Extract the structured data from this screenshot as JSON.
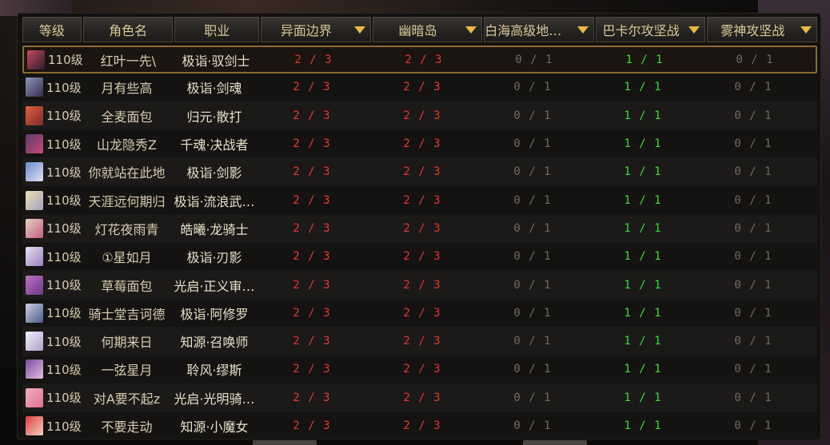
{
  "header": {
    "level": "等级",
    "name": "角色名",
    "job": "职业",
    "raids": [
      "异面边界",
      "幽暗岛",
      "白海高级地下…",
      "巴卡尔攻坚战",
      "雾神攻坚战"
    ]
  },
  "colors": {
    "red": "#e03a32",
    "gray": "#6e6a66",
    "green": "#3bdc3b",
    "header_text": "#d9c89a",
    "arrow": "#e8b84a",
    "selected_border": "#8a6a30"
  },
  "rows": [
    {
      "level": "110级",
      "name": "红叶一先\\",
      "job": "极诣·驭剑士",
      "r1": "2 / 3",
      "r2": "2 / 3",
      "r3": "0 / 1",
      "r4": "1 / 1",
      "r5": "0 / 1",
      "avatar": "avatar-icon",
      "selected": true
    },
    {
      "level": "110级",
      "name": "月有些高",
      "job": "极诣·剑魂",
      "r1": "2 / 3",
      "r2": "2 / 3",
      "r3": "0 / 1",
      "r4": "1 / 1",
      "r5": "0 / 1",
      "avatar": "avatar-icon"
    },
    {
      "level": "110级",
      "name": "全麦面包",
      "job": "归元·散打",
      "r1": "2 / 3",
      "r2": "2 / 3",
      "r3": "0 / 1",
      "r4": "1 / 1",
      "r5": "0 / 1",
      "avatar": "avatar-icon"
    },
    {
      "level": "110级",
      "name": "山龙隐秀Z",
      "job": "千魂·决战者",
      "r1": "2 / 3",
      "r2": "2 / 3",
      "r3": "0 / 1",
      "r4": "1 / 1",
      "r5": "0 / 1",
      "avatar": "avatar-icon"
    },
    {
      "level": "110级",
      "name": "你就站在此地",
      "job": "极诣·剑影",
      "r1": "2 / 3",
      "r2": "2 / 3",
      "r3": "0 / 1",
      "r4": "1 / 1",
      "r5": "0 / 1",
      "avatar": "avatar-icon"
    },
    {
      "level": "110级",
      "name": "天涯远何期归",
      "job": "极诣·流浪武…",
      "r1": "2 / 3",
      "r2": "2 / 3",
      "r3": "0 / 1",
      "r4": "1 / 1",
      "r5": "0 / 1",
      "avatar": "avatar-icon"
    },
    {
      "level": "110级",
      "name": "灯花夜雨青",
      "job": "皓曦·龙骑士",
      "r1": "2 / 3",
      "r2": "2 / 3",
      "r3": "0 / 1",
      "r4": "1 / 1",
      "r5": "0 / 1",
      "avatar": "avatar-icon"
    },
    {
      "level": "110级",
      "name": "①星如月",
      "job": "极诣·刃影",
      "r1": "2 / 3",
      "r2": "2 / 3",
      "r3": "0 / 1",
      "r4": "1 / 1",
      "r5": "0 / 1",
      "avatar": "avatar-icon"
    },
    {
      "level": "110级",
      "name": "草莓面包",
      "job": "光启·正义审…",
      "r1": "2 / 3",
      "r2": "2 / 3",
      "r3": "0 / 1",
      "r4": "1 / 1",
      "r5": "0 / 1",
      "avatar": "avatar-icon"
    },
    {
      "level": "110级",
      "name": "骑士堂吉诃德",
      "job": "极诣·阿修罗",
      "r1": "2 / 3",
      "r2": "2 / 3",
      "r3": "0 / 1",
      "r4": "1 / 1",
      "r5": "0 / 1",
      "avatar": "avatar-icon"
    },
    {
      "level": "110级",
      "name": "何期来日",
      "job": "知源·召唤师",
      "r1": "2 / 3",
      "r2": "2 / 3",
      "r3": "0 / 1",
      "r4": "1 / 1",
      "r5": "0 / 1",
      "avatar": "avatar-icon"
    },
    {
      "level": "110级",
      "name": "一弦星月",
      "job": "聆风·缪斯",
      "r1": "2 / 3",
      "r2": "2 / 3",
      "r3": "0 / 1",
      "r4": "1 / 1",
      "r5": "0 / 1",
      "avatar": "avatar-icon"
    },
    {
      "level": "110级",
      "name": "对A要不起z",
      "job": "光启·光明骑…",
      "r1": "2 / 3",
      "r2": "2 / 3",
      "r3": "0 / 1",
      "r4": "1 / 1",
      "r5": "0 / 1",
      "avatar": "avatar-icon"
    },
    {
      "level": "110级",
      "name": "不要走动",
      "job": "知源·小魔女",
      "r1": "2 / 3",
      "r2": "2 / 3",
      "r3": "0 / 1",
      "r4": "1 / 1",
      "r5": "0 / 1",
      "avatar": "avatar-icon"
    }
  ]
}
